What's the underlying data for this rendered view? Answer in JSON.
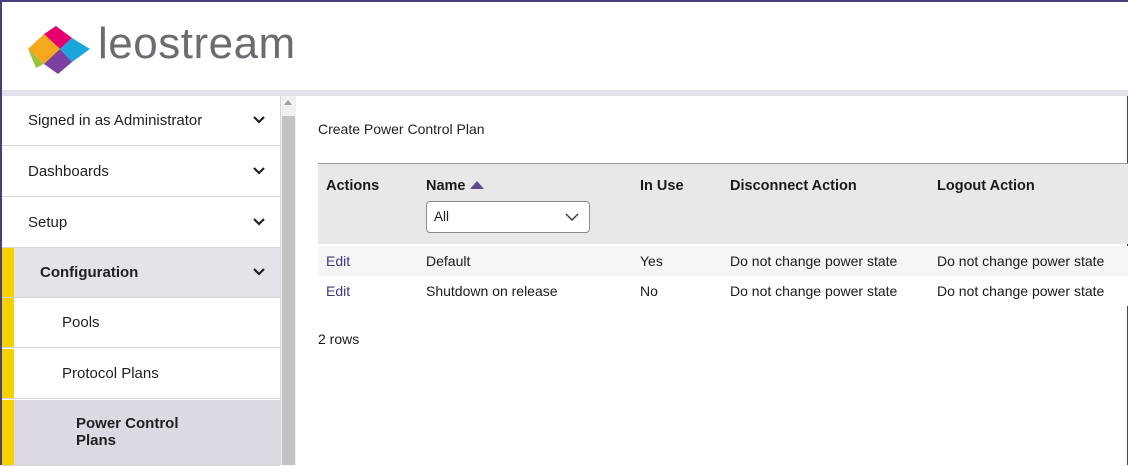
{
  "header": {
    "brand": "leostream"
  },
  "sidebar": {
    "items": [
      {
        "label": "Signed in as Administrator"
      },
      {
        "label": "Dashboards"
      },
      {
        "label": "Setup"
      },
      {
        "label": "Configuration"
      },
      {
        "label": "Pools"
      },
      {
        "label": "Protocol Plans"
      },
      {
        "label": "Power Control Plans"
      }
    ]
  },
  "main": {
    "create_link": "Create Power Control Plan",
    "columns": [
      "Actions",
      "Name",
      "In Use",
      "Disconnect Action",
      "Logout Action"
    ],
    "name_filter": {
      "value": "All"
    },
    "rows": [
      {
        "action": "Edit",
        "name": "Default",
        "in_use": "Yes",
        "disconnect": "Do not change power state",
        "logout": "Do not change power state"
      },
      {
        "action": "Edit",
        "name": "Shutdown on release",
        "in_use": "No",
        "disconnect": "Do not change power state",
        "logout": "Do not change power state"
      }
    ],
    "row_count": "2 rows"
  },
  "colors": {
    "accent_yellow": "#f5d100",
    "brand_purple": "#4b3d7a",
    "link": "#3d3a7c"
  }
}
